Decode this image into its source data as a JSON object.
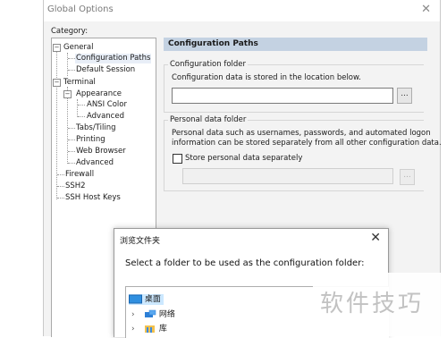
{
  "window": {
    "title": "Global Options"
  },
  "category_label": "Category:",
  "tree": {
    "general": "General",
    "configuration_paths": "Configuration Paths",
    "default_session": "Default Session",
    "terminal": "Terminal",
    "appearance": "Appearance",
    "ansi_color": "ANSI Color",
    "advanced_appearance": "Advanced",
    "tabs_tiling": "Tabs/Tiling",
    "printing": "Printing",
    "web_browser": "Web Browser",
    "advanced_terminal": "Advanced",
    "firewall": "Firewall",
    "ssh2": "SSH2",
    "ssh_host_keys": "SSH Host Keys"
  },
  "panel": {
    "header": "Configuration Paths",
    "config_folder": {
      "title": "Configuration folder",
      "description": "Configuration data is stored in the location below.",
      "value": "",
      "browse": "..."
    },
    "personal_folder": {
      "title": "Personal data folder",
      "description_1": "Personal data such as usernames, passwords, and automated logon",
      "description_2": "information can be stored separately from all other configuration data.",
      "checkbox_label": "Store personal data separately",
      "checked": false,
      "value": "",
      "browse": "..."
    }
  },
  "folder_dialog": {
    "title": "浏览文件夹",
    "prompt": "Select a folder to be used as the configuration folder:",
    "items": [
      {
        "label": "桌面",
        "icon": "desktop-icon",
        "selected": true
      },
      {
        "label": "网络",
        "icon": "network-icon",
        "selected": false
      },
      {
        "label": "库",
        "icon": "library-icon",
        "selected": false
      }
    ]
  },
  "watermark": "软件技巧",
  "colors": {
    "header_bar": "#c4d2e2",
    "selection": "#cce8ff",
    "dialog_bg": "#f3f3f3"
  }
}
